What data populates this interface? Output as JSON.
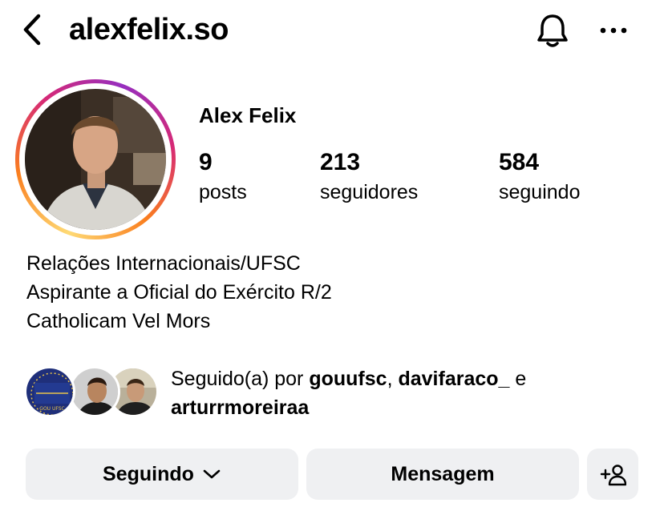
{
  "header": {
    "username": "alexfelix.so",
    "icons": {
      "back": "chevron-left-icon",
      "bell": "bell-icon",
      "more": "more-horizontal-icon"
    }
  },
  "profile": {
    "name": "Alex Felix",
    "stats": [
      {
        "value": "9",
        "label": "posts"
      },
      {
        "value": "213",
        "label": "seguidores"
      },
      {
        "value": "584",
        "label": "seguindo"
      }
    ],
    "bio": [
      "Relações Internacionais/UFSC",
      "Aspirante a Oficial do Exército R/2",
      "Catholicam Vel Mors"
    ]
  },
  "followed_by": {
    "prefix": "Seguido(a) por",
    "users": [
      "gouufsc",
      "davifaraco_",
      "arturrmoreiraa"
    ],
    "separator": ",",
    "conjunction": "e",
    "avatar_logo_text": "GOU UFSC"
  },
  "actions": {
    "following_label": "Seguindo",
    "message_label": "Mensagem",
    "icons": {
      "dropdown": "chevron-down-icon",
      "add_user": "add-user-icon"
    }
  },
  "colors": {
    "button_bg": "#eff0f2",
    "story_ring": [
      "#feda75",
      "#fa7e1e",
      "#d62976",
      "#962fbf"
    ]
  }
}
